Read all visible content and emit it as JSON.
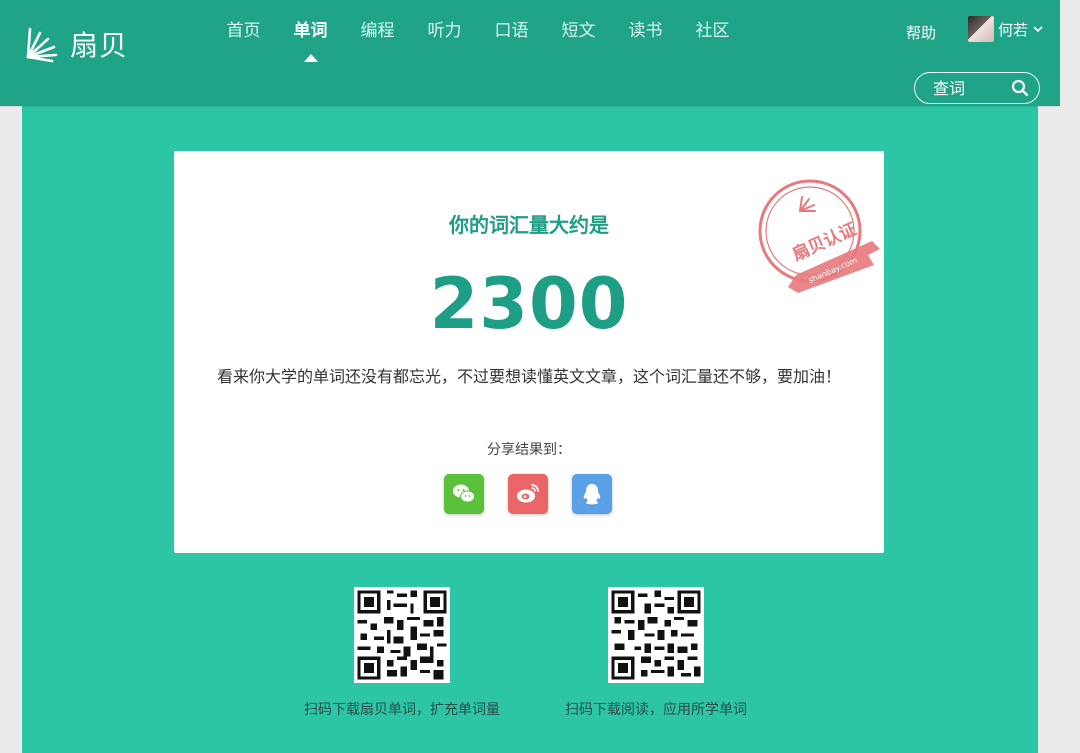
{
  "brand": {
    "name": "扇贝"
  },
  "nav": {
    "items": [
      {
        "label": "首页",
        "active": false
      },
      {
        "label": "单词",
        "active": true
      },
      {
        "label": "编程",
        "active": false
      },
      {
        "label": "听力",
        "active": false
      },
      {
        "label": "口语",
        "active": false
      },
      {
        "label": "短文",
        "active": false
      },
      {
        "label": "读书",
        "active": false
      },
      {
        "label": "社区",
        "active": false
      }
    ],
    "help": "帮助",
    "user": "何若"
  },
  "search": {
    "placeholder": "查词"
  },
  "result": {
    "title": "你的词汇量大约是",
    "number": "2300",
    "description": "看来你大学的单词还没有都忘光，不过要想读懂英文文章，这个词汇量还不够，要加油！",
    "share_label": "分享结果到：",
    "stamp_text": "扇贝认证",
    "stamp_url": "shanbay.com"
  },
  "share": [
    {
      "name": "wechat",
      "icon": "wechat-icon"
    },
    {
      "name": "weibo",
      "icon": "weibo-icon"
    },
    {
      "name": "qq",
      "icon": "qq-icon"
    }
  ],
  "qr": [
    {
      "caption": "扫码下载扇贝单词，扩充单词量"
    },
    {
      "caption": "扫码下载阅读，应用所学单词"
    }
  ],
  "colors": {
    "background": "#2cc5a6",
    "header": "#1fa488",
    "accent": "#1e9e84",
    "stamp": "#e8797d"
  }
}
